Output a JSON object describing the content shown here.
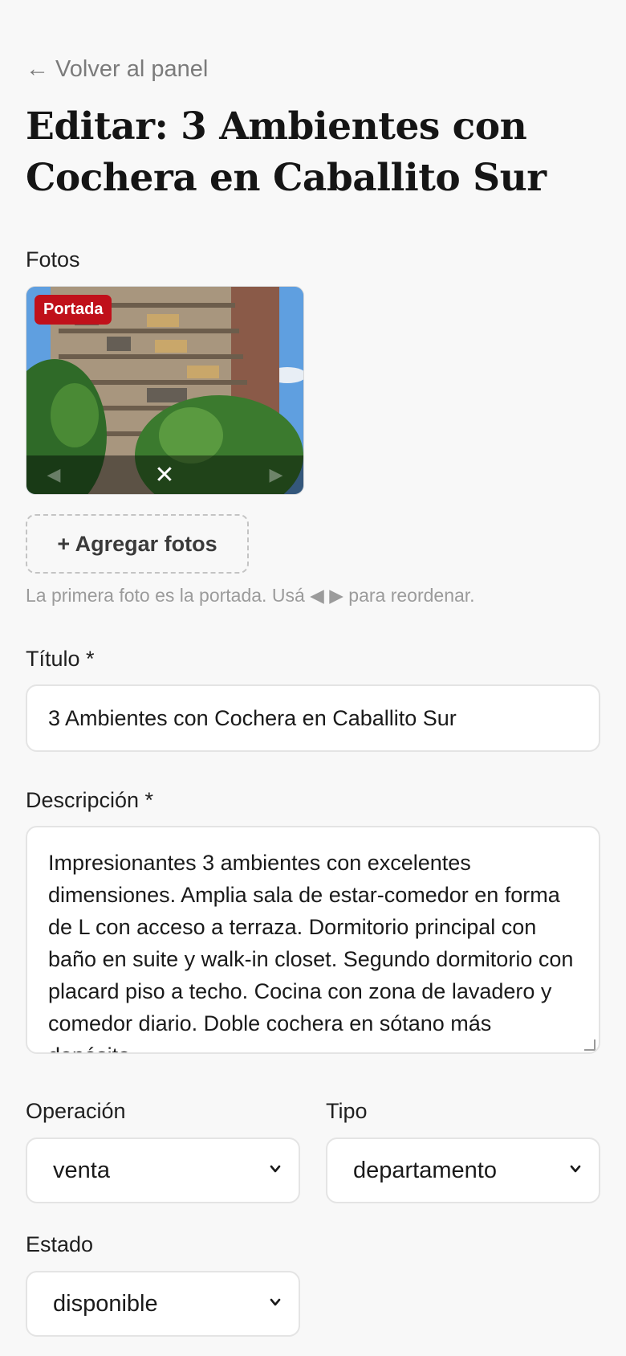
{
  "nav": {
    "back_label": "← Volver al panel"
  },
  "page": {
    "title": "Editar: 3 Ambientes con Cochera en Caballito Sur"
  },
  "photos": {
    "section_label": "Fotos",
    "items": [
      {
        "badge": "Portada",
        "prev_icon": "◀",
        "remove_icon": "✕",
        "next_icon": "▶"
      }
    ],
    "add_button_label": "+ Agregar fotos",
    "hint": "La primera foto es la portada. Usá ◀ ▶ para reordenar."
  },
  "form": {
    "title_label": "Título *",
    "title_value": "3 Ambientes con Cochera en Caballito Sur",
    "description_label": "Descripción *",
    "description_value": "Impresionantes 3 ambientes con excelentes dimensiones. Amplia sala de estar-comedor en forma de L con acceso a terraza. Dormitorio principal con baño en suite y walk-in closet. Segundo dormitorio con placard piso a techo. Cocina con zona de lavadero y comedor diario. Doble cochera en sótano más depósito.",
    "operation_label": "Operación",
    "operation_value": "venta",
    "type_label": "Tipo",
    "type_value": "departamento",
    "status_label": "Estado",
    "status_value": "disponible"
  },
  "colors": {
    "background": "#f8f8f8",
    "badge": "#c0101a",
    "muted_text": "#9b9b9b",
    "input_border": "#e4e4e4"
  }
}
